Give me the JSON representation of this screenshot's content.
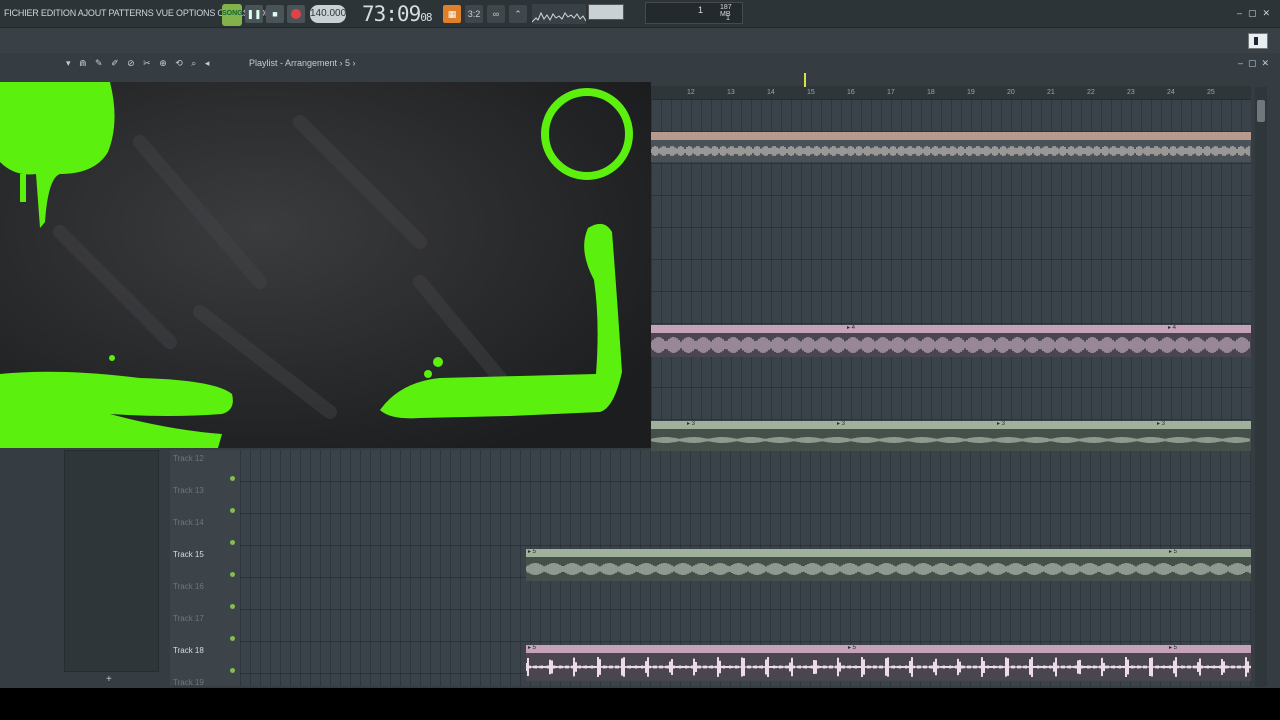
{
  "menu": {
    "text": "FICHIER EDITION AJOUT PATTERNS VUE OPTIONS OUTILS AIDE"
  },
  "transport": {
    "song_label": "SONG",
    "play": "❚❚",
    "stop": "■",
    "tempo": "140.000"
  },
  "time": {
    "main": "73:09",
    "sub": "08"
  },
  "tools": {
    "pattern_icon": "pattern-icon",
    "step_icon": "3:2",
    "loop_icon": "∞"
  },
  "cpu": {
    "value": "1",
    "memory": "187 MB",
    "poly": "1"
  },
  "playlist": {
    "title": "Playlist - Arrangement › 5 ›",
    "ruler": [
      "12",
      "13",
      "14",
      "15",
      "16",
      "17",
      "18",
      "19",
      "20",
      "21",
      "22",
      "23",
      "24",
      "25"
    ]
  },
  "tracks": [
    {
      "label": "Track 12",
      "active": false
    },
    {
      "label": "Track 13",
      "active": false
    },
    {
      "label": "Track 14",
      "active": false
    },
    {
      "label": "Track 15",
      "active": true
    },
    {
      "label": "Track 16",
      "active": false
    },
    {
      "label": "Track 17",
      "active": false
    },
    {
      "label": "Track 18",
      "active": true
    },
    {
      "label": "Track 19",
      "active": false
    }
  ],
  "clips": {
    "pink_label": "▸ 4",
    "green_label": "▸ 3",
    "track15_label": "▸ 5",
    "track18_label": "▸ 5"
  },
  "colors": {
    "accent": "#83b24b",
    "green_paint": "#5cf00e",
    "pink_clip": "#c6a2b8",
    "sage_clip": "#9fb19d"
  },
  "browser": {
    "add_label": "+"
  }
}
